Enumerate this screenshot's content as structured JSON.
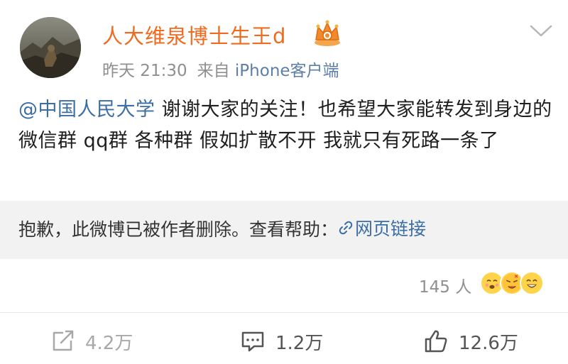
{
  "post": {
    "user": {
      "name": "人大维泉博士生王d",
      "avatar_icon": "avatar-photo",
      "badge_icon": "vip-crown-icon"
    },
    "meta": {
      "time": "昨天 21:30",
      "source_prefix": "来自",
      "source": "iPhone客户端"
    },
    "text": {
      "mention": "@中国人民大学",
      "body": " 谢谢大家的关注！也希望大家能转发到身边的微信群 qq群 各种群 假如扩散不开 我就只有死路一条了"
    },
    "repost": {
      "notice": "抱歉，此微博已被作者删除。查看帮助：",
      "link_label": "网页链接",
      "link_icon": "link-icon"
    },
    "reactions": {
      "count": "145 人",
      "emoji_icons": [
        "emoji-1-icon",
        "emoji-2-icon",
        "emoji-3-icon"
      ]
    },
    "actions": {
      "repost": "4.2万",
      "comment": "1.2万",
      "like": "12.6万"
    }
  },
  "colors": {
    "username": "#f06a1f",
    "link": "#3b6ea5",
    "meta": "#8f8f8f",
    "repost_background": "#f2f2f2"
  }
}
